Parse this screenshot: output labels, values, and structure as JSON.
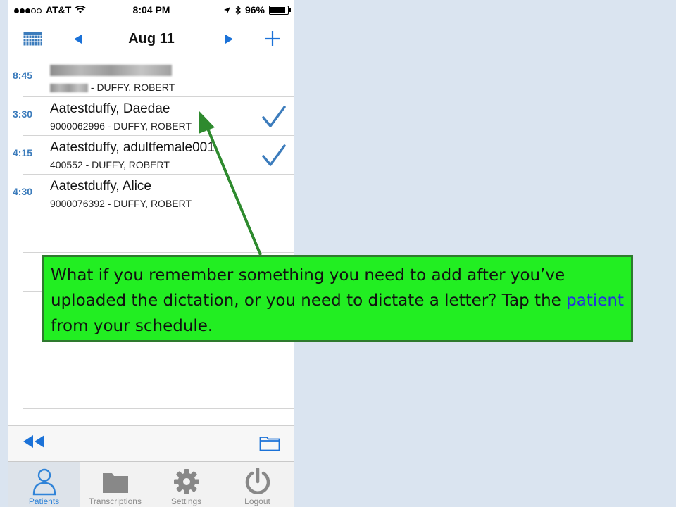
{
  "status_bar": {
    "carrier": "AT&T",
    "time": "8:04 PM",
    "battery": "96%"
  },
  "nav": {
    "title": "Aug 11",
    "calendar_icon": "calendar-grid-icon",
    "prev_icon": "triangle-left-icon",
    "next_icon": "triangle-right-icon",
    "add_icon": "plus-icon"
  },
  "appointments": [
    {
      "time": "8:45",
      "name": "",
      "sub": " - DUFFY, ROBERT",
      "blurred": true,
      "checked": false
    },
    {
      "time": "3:30",
      "name": "Aatestduffy, Daedae",
      "sub": "9000062996 - DUFFY, ROBERT",
      "checked": true
    },
    {
      "time": "4:15",
      "name": "Aatestduffy, adultfemale001",
      "sub": "400552 - DUFFY, ROBERT",
      "checked": true
    },
    {
      "time": "4:30",
      "name": "Aatestduffy, Alice",
      "sub": "9000076392 - DUFFY, ROBERT",
      "checked": false
    }
  ],
  "toolbar": {
    "rewind_icon": "rewind-icon",
    "folder_icon": "folder-outline-icon"
  },
  "tabs": [
    {
      "label": "Patients",
      "icon": "person-icon",
      "active": true
    },
    {
      "label": "Transcriptions",
      "icon": "folder-icon",
      "active": false
    },
    {
      "label": "Settings",
      "icon": "gear-icon",
      "active": false
    },
    {
      "label": "Logout",
      "icon": "power-icon",
      "active": false
    }
  ],
  "callout": {
    "text_before": "What if you remember something you need to add after you’ve uploaded the dictation, or you need to dictate a letter?  Tap the ",
    "highlight": "patient",
    "text_after": " from your schedule."
  },
  "colors": {
    "accent": "#2f83d8",
    "time_blue": "#3c7cbc",
    "callout_bg": "#22ee22",
    "callout_border": "#2e7a2e",
    "highlight": "#2233dd",
    "page_bg": "#dae4f0"
  }
}
